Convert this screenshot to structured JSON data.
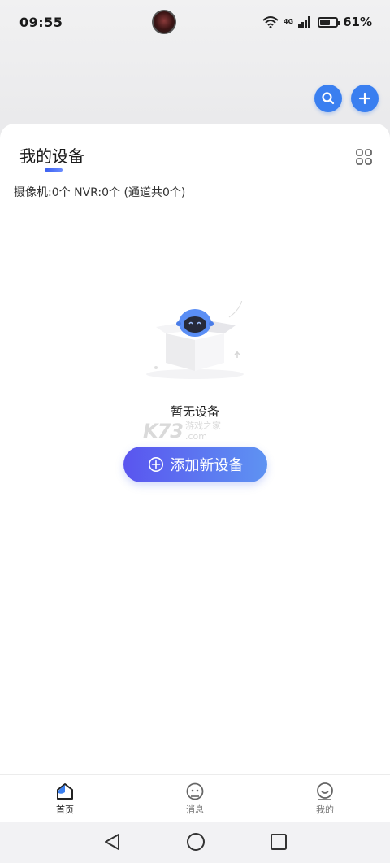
{
  "status_bar": {
    "time": "09:55",
    "network": "4G",
    "battery_percent": "61%"
  },
  "header": {
    "search_icon": "search-icon",
    "add_icon": "plus-icon",
    "accent_color": "#3a7ff0"
  },
  "devices": {
    "title": "我的设备",
    "summary": "摄像机:0个 NVR:0个 (通道共0个)",
    "empty_text": "暂无设备",
    "add_button_label": "添加新设备",
    "watermark_logo": "K73",
    "watermark_sub": "游戏之家",
    "watermark_domain": ".com"
  },
  "bottom_nav": {
    "items": [
      {
        "label": "首页",
        "icon": "home-icon",
        "active": true
      },
      {
        "label": "消息",
        "icon": "message-icon",
        "active": false
      },
      {
        "label": "我的",
        "icon": "profile-icon",
        "active": false
      }
    ]
  },
  "system_nav": {
    "back_icon": "back-triangle-icon",
    "home_icon": "home-circle-icon",
    "recents_icon": "recents-square-icon"
  }
}
